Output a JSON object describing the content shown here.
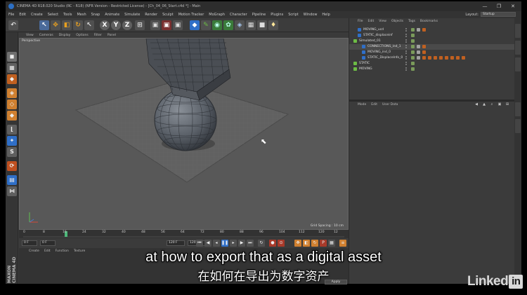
{
  "window": {
    "title": "CINEMA 4D R18.020 Studio (RC - R18) (NFR Version - Restricted License) - [Ch_04_06_Start.c4d *] - Main",
    "controls": [
      "—",
      "❐",
      "✕"
    ]
  },
  "menubar": {
    "items": [
      "File",
      "Edit",
      "Create",
      "Select",
      "Tools",
      "Mesh",
      "Snap",
      "Animate",
      "Simulate",
      "Render",
      "Sculpt",
      "Motion Tracker",
      "MoGraph",
      "Character",
      "Pipeline",
      "Plugins",
      "Script",
      "Window",
      "Help"
    ],
    "layout_label": "Layout:",
    "layout_value": "Startup"
  },
  "viewport": {
    "menu": [
      "View",
      "Cameras",
      "Display",
      "Options",
      "Filter",
      "Panel"
    ],
    "label": "Perspective",
    "grid_spacing": "Grid Spacing : 10 cm"
  },
  "timeline": {
    "ticks": [
      "0",
      "8",
      "16",
      "24",
      "32",
      "40",
      "48",
      "56",
      "64",
      "72",
      "80",
      "88",
      "96",
      "104",
      "112",
      "120"
    ],
    "current_frame": "12"
  },
  "playbar": {
    "start_field": "0 F",
    "min_field": "0 F",
    "end_field": "120 F",
    "max_field": "120 F"
  },
  "material": {
    "menu": [
      "Create",
      "Edit",
      "Function",
      "Texture"
    ],
    "brand": "MAXON CINEMA 4D"
  },
  "objects": {
    "menu": [
      "File",
      "Edit",
      "View",
      "Objects",
      "Tags",
      "Bookmarks"
    ],
    "rows": [
      {
        "name": "MOVING_ucd",
        "indent": 0
      },
      {
        "name": "STATIC_displaceinf",
        "indent": 0
      },
      {
        "name": "Simulated_01",
        "indent": 0
      },
      {
        "name": "CONNECTIONS_ind_1",
        "indent": 1
      },
      {
        "name": "MOVING_ind_0",
        "indent": 1
      },
      {
        "name": "STATIC_DisplaceInfo_0",
        "indent": 1
      },
      {
        "name": "STATIC",
        "indent": 0
      },
      {
        "name": "MOVING",
        "indent": 0
      }
    ]
  },
  "attributes": {
    "menu": [
      "Mode",
      "Edit",
      "User Data"
    ]
  },
  "scene_button": {
    "apply": "Apply"
  },
  "subtitles": {
    "english": "at how to export that as a digital asset",
    "chinese": "在如何在导出为数字资产"
  },
  "branding": {
    "linkedin_text": "Linked",
    "linkedin_box": "in"
  },
  "colors": {
    "accent_blue": "#2c6fc4",
    "viewport_bg": "#585858",
    "ui_bg": "#3a3a3a"
  }
}
